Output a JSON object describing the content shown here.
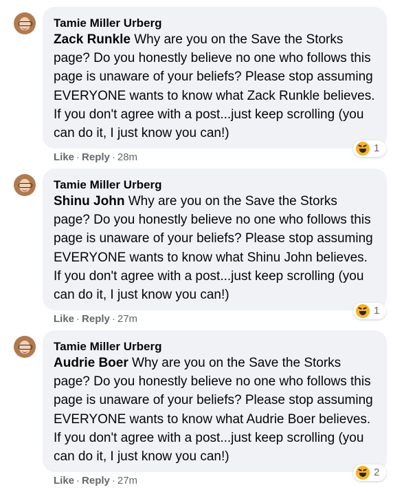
{
  "comments": [
    {
      "author": "Tamie Miller Urberg",
      "mention": "Zack Runkle",
      "text": " Why are you on the Save the Storks page? Do you honestly believe no one who follows this page is unaware of your beliefs? Please stop assuming EVERYONE wants to know what Zack Runkle believes. If you don't agree with a post...just keep scrolling (you can do it, I just know you can!)",
      "like_label": "Like",
      "reply_label": "Reply",
      "time": "28m",
      "reaction_icon": "haha-emoji-icon",
      "reaction_count": "1"
    },
    {
      "author": "Tamie Miller Urberg",
      "mention": "Shinu John",
      "text": " Why are you on the Save the Storks page? Do you honestly believe no one who follows this page is unaware of your beliefs? Please stop assuming EVERYONE wants to know what Shinu John believes. If you don't agree with a post...just keep scrolling (you can do it, I just know you can!)",
      "like_label": "Like",
      "reply_label": "Reply",
      "time": "27m",
      "reaction_icon": "haha-emoji-icon",
      "reaction_count": "1"
    },
    {
      "author": "Tamie Miller Urberg",
      "mention": "Audrie Boer",
      "text": " Why are you on the Save the Storks page? Do you honestly believe no one who follows this page is unaware of your beliefs? Please stop assuming EVERYONE wants to know what Audrie Boer believes. If you don't agree with a post...just keep scrolling (you can do it, I just know you can!)",
      "like_label": "Like",
      "reply_label": "Reply",
      "time": "27m",
      "reaction_icon": "haha-emoji-icon",
      "reaction_count": "2"
    }
  ],
  "separator": "·"
}
